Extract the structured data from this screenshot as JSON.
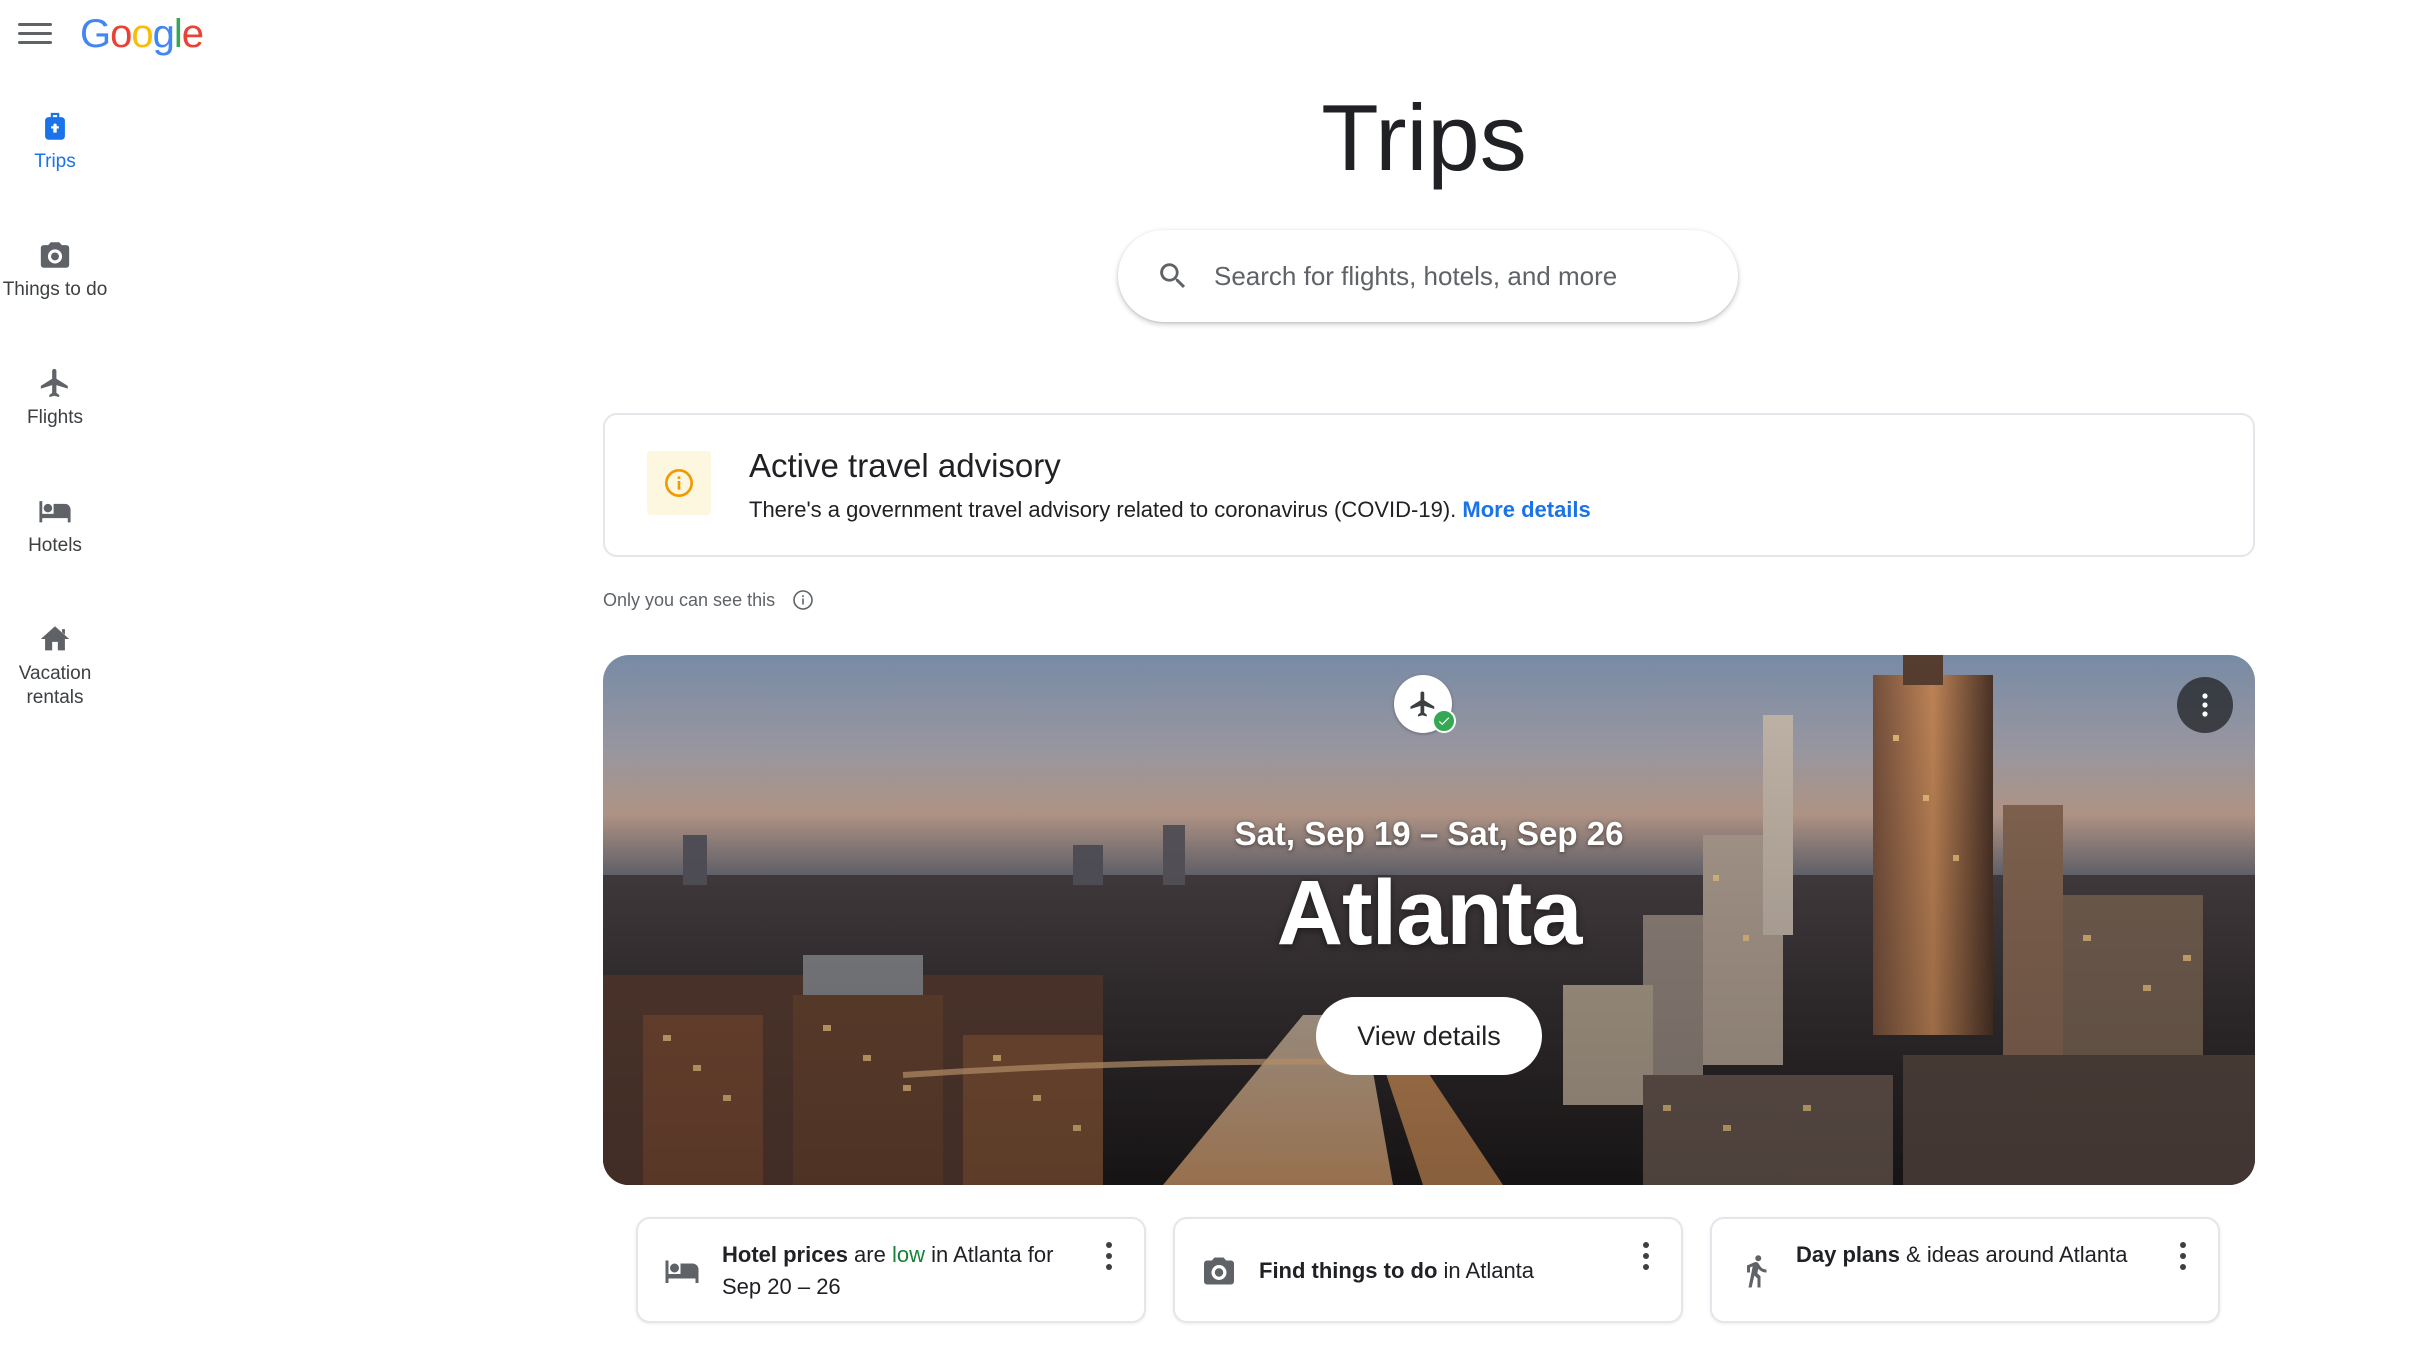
{
  "header": {
    "logo": "Google",
    "logo_letters": [
      "G",
      "o",
      "o",
      "g",
      "l",
      "e"
    ],
    "logo_colors": [
      "#4285F4",
      "#EA4335",
      "#FBBC05",
      "#4285F4",
      "#34A853",
      "#EA4335"
    ]
  },
  "sidebar": {
    "items": [
      {
        "label": "Trips",
        "icon": "luggage-icon",
        "active": true
      },
      {
        "label": "Things to do",
        "icon": "camera-icon",
        "active": false
      },
      {
        "label": "Flights",
        "icon": "airplane-icon",
        "active": false
      },
      {
        "label": "Hotels",
        "icon": "bed-icon",
        "active": false
      },
      {
        "label": "Vacation rentals",
        "icon": "house-icon",
        "active": false
      }
    ]
  },
  "main": {
    "title": "Trips",
    "search": {
      "placeholder": "Search for flights, hotels, and more"
    },
    "advisory": {
      "title": "Active travel advisory",
      "text": "There's a government travel advisory related to coronavirus (COVID-19).",
      "link": "More details"
    },
    "privacy_note": "Only you can see this",
    "trip": {
      "dates": "Sat, Sep 19 – Sat, Sep 26",
      "city": "Atlanta",
      "button": "View details"
    },
    "cards": [
      {
        "icon": "bed-icon",
        "parts": [
          {
            "t": "Hotel prices",
            "style": "bold"
          },
          {
            "t": " are ",
            "style": "plain"
          },
          {
            "t": "low",
            "style": "green"
          },
          {
            "t": " in Atlanta for Sep 20 – 26",
            "style": "plain"
          }
        ]
      },
      {
        "icon": "camera-icon",
        "parts": [
          {
            "t": "Find things to do",
            "style": "bold"
          },
          {
            "t": " in Atlanta",
            "style": "plain"
          }
        ]
      },
      {
        "icon": "walking-icon",
        "parts": [
          {
            "t": "Day plans",
            "style": "bold"
          },
          {
            "t": " & ideas around Atlanta",
            "style": "plain"
          }
        ]
      }
    ]
  },
  "colors": {
    "accent": "#1a73e8",
    "green": "#188038",
    "advisory_bg": "#fef7e0",
    "advisory_icon": "#f29900"
  }
}
